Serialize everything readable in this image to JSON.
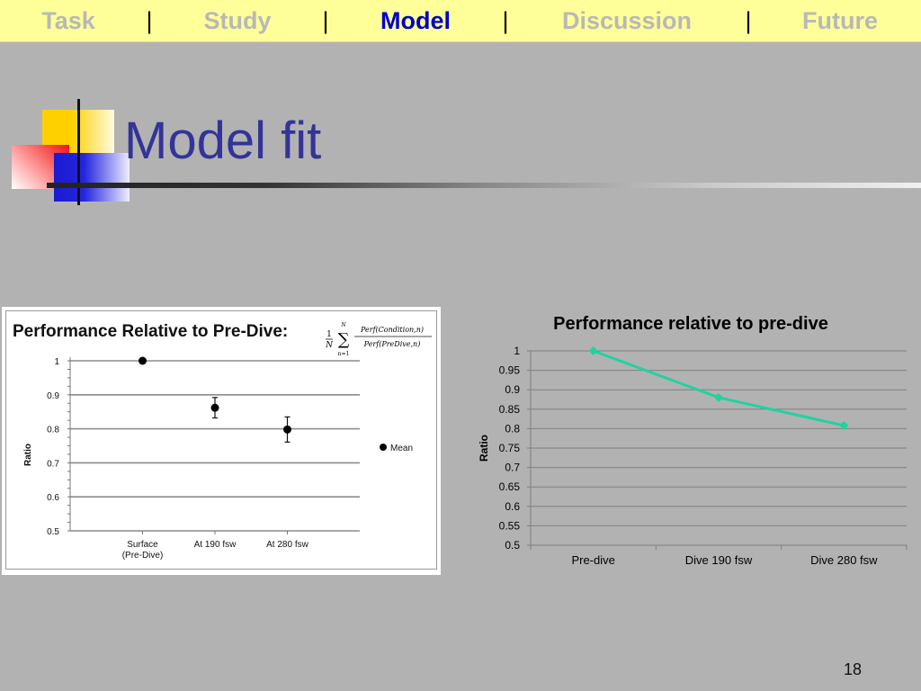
{
  "nav": {
    "items": [
      {
        "label": "Task",
        "color": "#b8b8b8"
      },
      {
        "label": "Study",
        "color": "#b8b8b8"
      },
      {
        "label": "Model",
        "color": "#0000cc"
      },
      {
        "label": "Discussion",
        "color": "#b8b8b8"
      },
      {
        "label": "Future",
        "color": "#b8b8b8"
      }
    ],
    "separator": "|",
    "active": "Model"
  },
  "slide": {
    "title": "Model fit",
    "page_number": "18"
  },
  "chart_data": [
    {
      "type": "scatter",
      "title": "Performance Relative to Pre-Dive:",
      "formula": {
        "one": "1",
        "N": "N",
        "sum_upper": "N",
        "sum_lower": "n=1",
        "numerator": "Perf(Condition,n)",
        "denominator": "Perf(PreDive,n)"
      },
      "categories": [
        "Surface\n(Pre-Dive)",
        "At 190 fsw",
        "At 280 fsw"
      ],
      "series": [
        {
          "name": "Mean",
          "values": [
            1.0,
            0.862,
            0.798
          ],
          "error": [
            0,
            0.03,
            0.037
          ],
          "color": "#000000"
        }
      ],
      "ylabel": "Ratio",
      "ylim": [
        0.5,
        1.0
      ],
      "yticks": [
        "0.5",
        "0.6",
        "0.7",
        "0.8",
        "0.9",
        "1"
      ],
      "grid": true,
      "legend": "right"
    },
    {
      "type": "line",
      "title": "Performance relative to pre-dive",
      "categories": [
        "Pre-dive",
        "Dive 190 fsw",
        "Dive 280 fsw"
      ],
      "series": [
        {
          "values": [
            1.0,
            0.88,
            0.808
          ],
          "color": "#1fd3a0"
        }
      ],
      "ylabel": "Ratio",
      "ylim": [
        0.5,
        1.0
      ],
      "yticks": [
        "0.5",
        "0.55",
        "0.6",
        "0.65",
        "0.7",
        "0.75",
        "0.8",
        "0.85",
        "0.9",
        "0.95",
        "1"
      ],
      "grid": true,
      "legend": "none"
    }
  ]
}
